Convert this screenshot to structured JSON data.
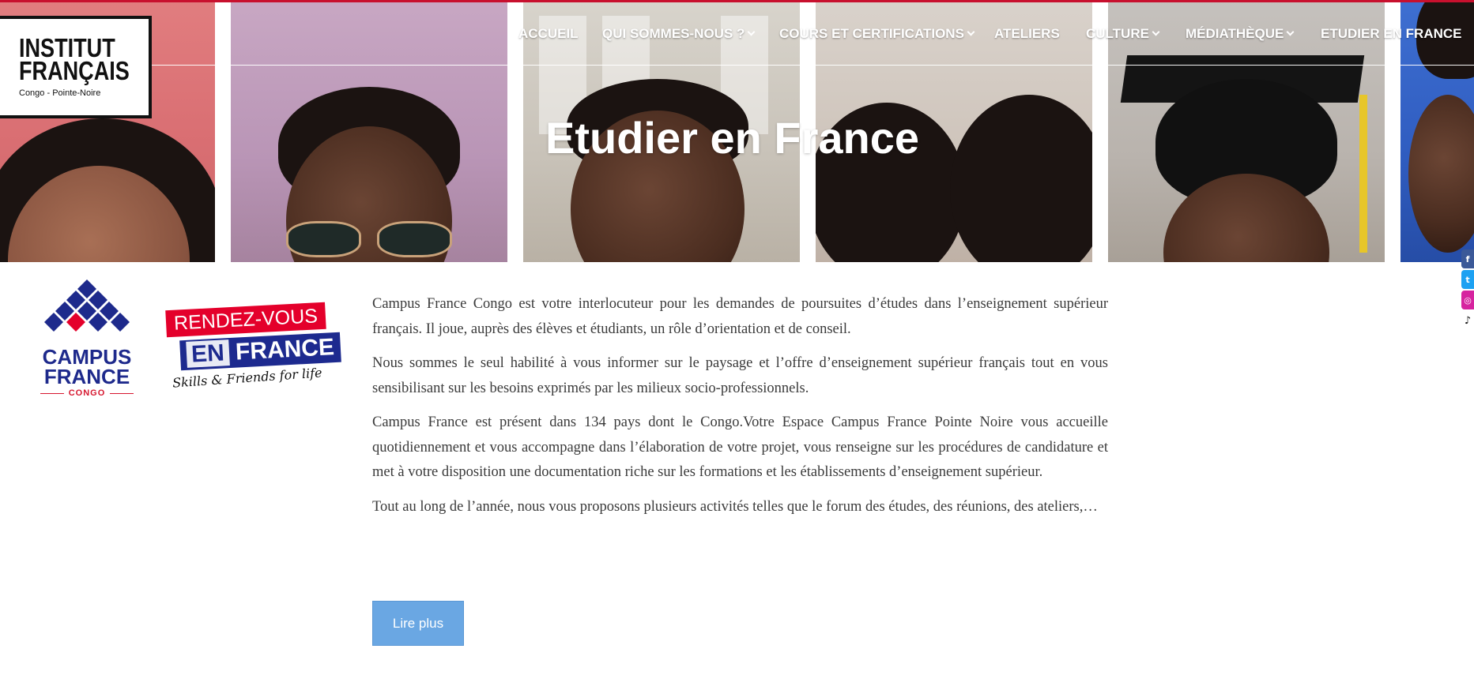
{
  "brand": {
    "logo_line1": "INSTITUT",
    "logo_line2": "FRANÇAIS",
    "logo_subtitle": "Congo - Pointe-Noire"
  },
  "nav": {
    "items": [
      {
        "label": "ACCUEIL",
        "has_dropdown": false
      },
      {
        "label": "QUI SOMMES-NOUS ?",
        "has_dropdown": true
      },
      {
        "label": "COURS ET CERTIFICATIONS",
        "has_dropdown": true
      },
      {
        "label": "ATELIERS",
        "has_dropdown": false
      },
      {
        "label": "CULTURE",
        "has_dropdown": true
      },
      {
        "label": "MÉDIATHÈQUE",
        "has_dropdown": true
      },
      {
        "label": "ETUDIER EN FRANCE",
        "has_dropdown": false
      }
    ]
  },
  "hero": {
    "title": "Etudier en France"
  },
  "social": {
    "icons": [
      "facebook-icon",
      "twitter-icon",
      "instagram-icon",
      "tiktok-icon"
    ]
  },
  "campus_logo": {
    "line1": "CAMPUS",
    "line2": "FRANCE",
    "sub": "CONGO"
  },
  "rdv_logo": {
    "line1": "RENDEZ-VOUS",
    "line2_a": "EN",
    "line2_b": "FRANCE",
    "tagline": "Skills & Friends for life"
  },
  "article": {
    "paragraphs": [
      "Campus France Congo est votre interlocuteur pour les demandes de poursuites d’études dans l’enseignement supérieur français. Il joue, auprès des élèves et étudiants, un rôle d’orientation et de conseil.",
      "Nous sommes le seul habilité à vous informer sur le paysage et l’offre d’enseignement supérieur français tout en vous sensibilisant sur les besoins exprimés par les milieux socio-professionnels.",
      "Campus France est présent dans 134 pays dont le Congo.Votre Espace Campus France Pointe Noire vous accueille quotidiennement et vous accompagne dans l’élaboration de votre projet, vous renseigne sur les procédures de candidature et met à votre disposition une documentation riche sur les formations et les établissements d’enseignement supérieur.",
      "Tout au long de l’année, nous vous proposons plusieurs activités telles que le forum des études, des réunions, des ateliers,…"
    ],
    "read_more_label": "Lire plus"
  },
  "colors": {
    "accent_red": "#c8102e",
    "campus_blue": "#1e2a8c",
    "button_blue": "#6aa7e3"
  }
}
